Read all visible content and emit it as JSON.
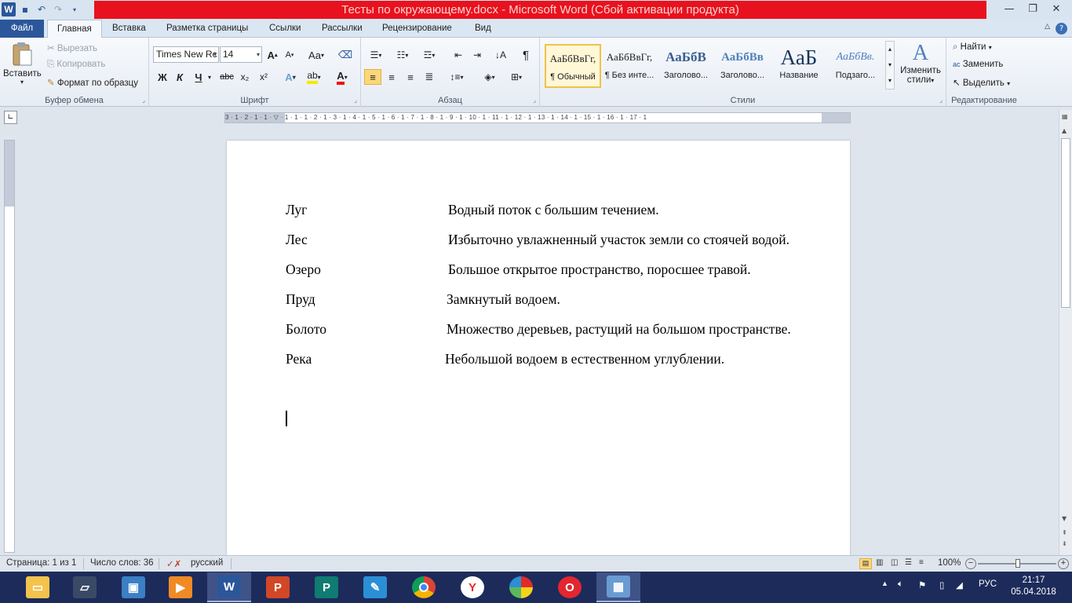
{
  "window": {
    "title": "Тесты по окружающему.docx  -  Microsoft Word (Сбой активации продукта)",
    "qat_icons": [
      "word-logo-icon",
      "save-icon",
      "undo-icon",
      "redo-icon",
      "customize-icon"
    ],
    "controls": [
      "minimize-icon",
      "restore-icon",
      "close-icon"
    ]
  },
  "tabs": [
    "Файл",
    "Главная",
    "Вставка",
    "Разметка страницы",
    "Ссылки",
    "Рассылки",
    "Рецензирование",
    "Вид"
  ],
  "ribbon": {
    "clipboard": {
      "label": "Буфер обмена",
      "paste": "Вставить",
      "cut": "Вырезать",
      "copy": "Копировать",
      "format_painter": "Формат по образцу"
    },
    "font": {
      "label": "Шрифт",
      "family": "Times New Rc",
      "size": "14",
      "bold": "Ж",
      "italic": "К",
      "underline": "Ч",
      "strike": "abc",
      "subscript": "x₂",
      "superscript": "x²",
      "grow": "A",
      "shrink": "A",
      "case": "Aa"
    },
    "paragraph": {
      "label": "Абзац",
      "pilcrow": "¶"
    },
    "styles": {
      "label": "Стили",
      "items": [
        {
          "preview": "АаБбВвГг,",
          "name": "¶ Обычный"
        },
        {
          "preview": "АаБбВвГг,",
          "name": "¶ Без инте..."
        },
        {
          "preview": "АаБбВ",
          "name": "Заголово..."
        },
        {
          "preview": "АаБбВв",
          "name": "Заголово..."
        },
        {
          "preview": "АаБ",
          "name": "Название"
        },
        {
          "preview": "АаБбВв.",
          "name": "Подзаго..."
        }
      ],
      "change_styles_line1": "Изменить",
      "change_styles_line2": "стили"
    },
    "editing": {
      "label": "Редактирование",
      "find": "Найти",
      "replace": "Заменить",
      "select": "Выделить"
    }
  },
  "ruler": {
    "numbers": "3 · 1 · 2 · 1 · 1 · ▽ · 1 · 1 · 1 · 2 · 1 · 3 · 1 · 4 · 1 · 5 · 1 · 6 · 1 · 7 · 1 · 8 · 1 · 9 · 1 · 10 · 1 · 11 · 1 · 12 · 1 · 13 · 1 · 14 · 1 · 15 · 1 · 16 · 1 · 17 · 1"
  },
  "document": {
    "rows": [
      {
        "term": "Луг",
        "definition": "Водный поток с большим течением."
      },
      {
        "term": "Лес",
        "definition": "Избыточно увлажненный участок земли со стоячей водой."
      },
      {
        "term": "Озеро",
        "definition": "Большое открытое пространство, поросшее травой."
      },
      {
        "term": "Пруд",
        "definition": "Замкнутый водоем."
      },
      {
        "term": "Болото",
        "definition": "Множество деревьев, растущий на большом пространстве."
      },
      {
        "term": "Река",
        "definition": "Небольшой водоем в естественном  углублении."
      }
    ]
  },
  "status": {
    "page": "Страница: 1 из 1",
    "words": "Число слов: 36",
    "language": "русский",
    "zoom": "100%",
    "zoom_minus": "−",
    "zoom_plus": "+"
  },
  "taskbar": {
    "apps": [
      {
        "name": "file-explorer",
        "icon": "folder-icon",
        "color": "#f3c34d"
      },
      {
        "name": "laptop",
        "icon": "laptop-icon",
        "color": "#3a4a66"
      },
      {
        "name": "app-3",
        "icon": "app-icon",
        "color": "#3b7fc4"
      },
      {
        "name": "video",
        "icon": "video-icon",
        "color": "#f08a24"
      },
      {
        "name": "word",
        "icon": "word-icon",
        "color": "#2b579a",
        "active": true
      },
      {
        "name": "powerpoint",
        "icon": "powerpoint-icon",
        "color": "#d24726"
      },
      {
        "name": "publisher",
        "icon": "publisher-icon",
        "color": "#0f7b72"
      },
      {
        "name": "notepad",
        "icon": "notepad-icon",
        "color": "#2b8fd6"
      },
      {
        "name": "chrome",
        "icon": "chrome-icon",
        "color": "#e0b12f"
      },
      {
        "name": "yandex",
        "icon": "yandex-icon",
        "color": "#e22a2a"
      },
      {
        "name": "app-paint",
        "icon": "paint-icon",
        "color": "#5cb85c"
      },
      {
        "name": "opera",
        "icon": "opera-icon",
        "color": "#e3262f"
      },
      {
        "name": "photos",
        "icon": "photos-icon",
        "color": "#6a9bd1"
      }
    ],
    "tray_lang": "РУС",
    "time": "21:17",
    "date": "05.04.2018"
  },
  "colors": {
    "titlebar_red": "#e8121e",
    "word_blue": "#2b579a",
    "taskbar": "#1c2b5a"
  }
}
